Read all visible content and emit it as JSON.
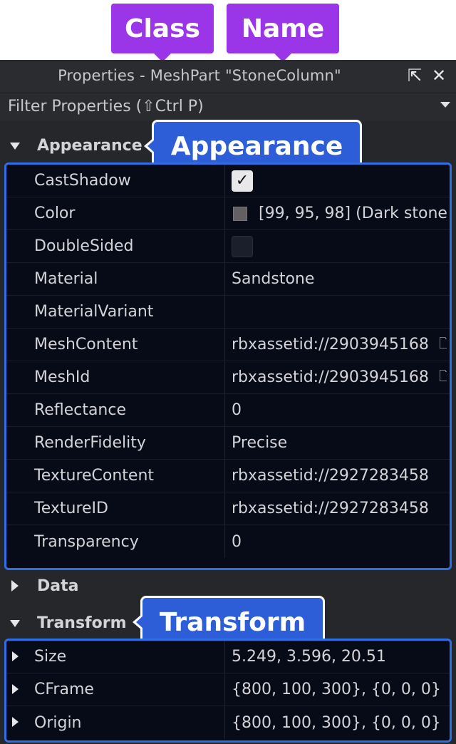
{
  "callouts": {
    "class_label": "Class",
    "name_label": "Name",
    "appearance_label": "Appearance",
    "transform_label": "Transform"
  },
  "window": {
    "title": "Properties - MeshPart \"StoneColumn\"",
    "filter_text": "Filter Properties (⇧Ctrl P)"
  },
  "sections": {
    "appearance": "Appearance",
    "data": "Data",
    "transform": "Transform"
  },
  "appearance_rows": [
    {
      "name": "CastShadow",
      "checked": true
    },
    {
      "name": "Color",
      "value": "[99, 95, 98] (Dark stone…",
      "swatch": "#635f62"
    },
    {
      "name": "DoubleSided",
      "checked": false
    },
    {
      "name": "Material",
      "value": "Sandstone"
    },
    {
      "name": "MaterialVariant",
      "value": ""
    },
    {
      "name": "MeshContent",
      "value": "rbxassetid://2903945168"
    },
    {
      "name": "MeshId",
      "value": "rbxassetid://2903945168"
    },
    {
      "name": "Reflectance",
      "value": "0"
    },
    {
      "name": "RenderFidelity",
      "value": "Precise"
    },
    {
      "name": "TextureContent",
      "value": "rbxassetid://2927283458"
    },
    {
      "name": "TextureID",
      "value": "rbxassetid://2927283458"
    },
    {
      "name": "Transparency",
      "value": "0"
    }
  ],
  "transform_rows": [
    {
      "name": "Size",
      "value": "5.249, 3.596, 20.51"
    },
    {
      "name": "CFrame",
      "value": "{800, 100, 300}, {0, 0, 0}"
    },
    {
      "name": "Origin",
      "value": "{800, 100, 300}, {0, 0, 0}"
    }
  ],
  "colors": {
    "purple_callout": "#9b35e8",
    "blue_callout": "#2d5ed8",
    "highlight_border": "#2f6fe6"
  }
}
